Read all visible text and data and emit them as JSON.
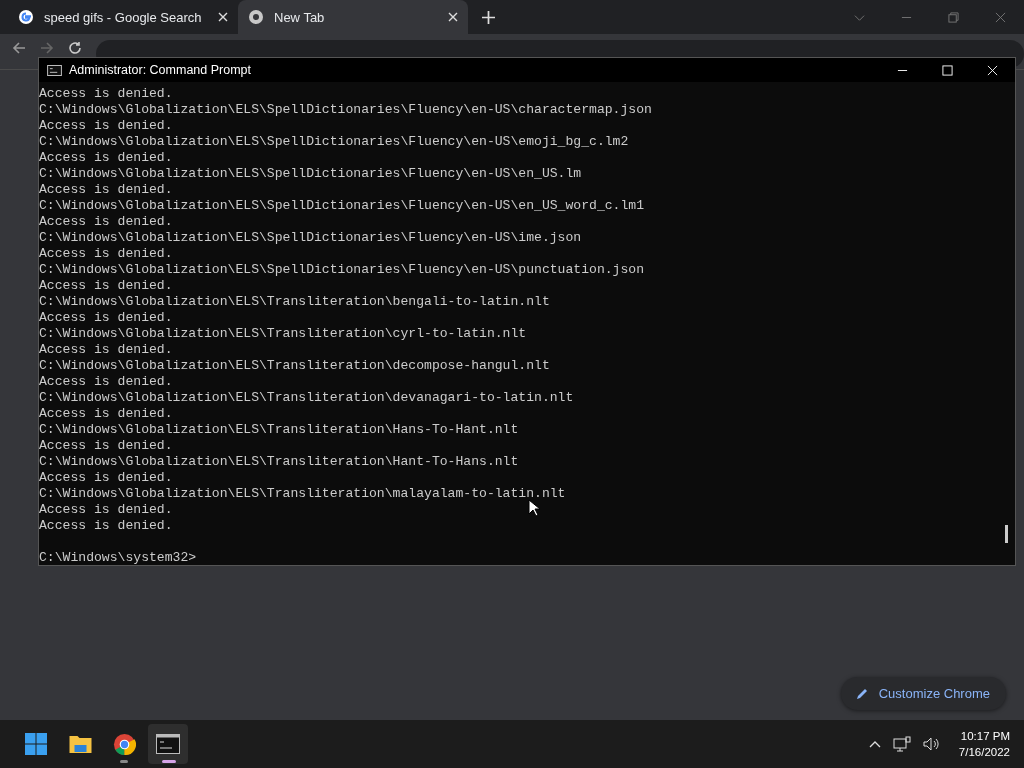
{
  "browser": {
    "tabs": [
      {
        "title": "speed gifs - Google Search",
        "selected": false
      },
      {
        "title": "New Tab",
        "selected": true
      }
    ],
    "customize_button": "Customize Chrome"
  },
  "console": {
    "title": "Administrator: Command Prompt",
    "lines": [
      "Access is denied.",
      "C:\\Windows\\Globalization\\ELS\\SpellDictionaries\\Fluency\\en-US\\charactermap.json",
      "Access is denied.",
      "C:\\Windows\\Globalization\\ELS\\SpellDictionaries\\Fluency\\en-US\\emoji_bg_c.lm2",
      "Access is denied.",
      "C:\\Windows\\Globalization\\ELS\\SpellDictionaries\\Fluency\\en-US\\en_US.lm",
      "Access is denied.",
      "C:\\Windows\\Globalization\\ELS\\SpellDictionaries\\Fluency\\en-US\\en_US_word_c.lm1",
      "Access is denied.",
      "C:\\Windows\\Globalization\\ELS\\SpellDictionaries\\Fluency\\en-US\\ime.json",
      "Access is denied.",
      "C:\\Windows\\Globalization\\ELS\\SpellDictionaries\\Fluency\\en-US\\punctuation.json",
      "Access is denied.",
      "C:\\Windows\\Globalization\\ELS\\Transliteration\\bengali-to-latin.nlt",
      "Access is denied.",
      "C:\\Windows\\Globalization\\ELS\\Transliteration\\cyrl-to-latin.nlt",
      "Access is denied.",
      "C:\\Windows\\Globalization\\ELS\\Transliteration\\decompose-hangul.nlt",
      "Access is denied.",
      "C:\\Windows\\Globalization\\ELS\\Transliteration\\devanagari-to-latin.nlt",
      "Access is denied.",
      "C:\\Windows\\Globalization\\ELS\\Transliteration\\Hans-To-Hant.nlt",
      "Access is denied.",
      "C:\\Windows\\Globalization\\ELS\\Transliteration\\Hant-To-Hans.nlt",
      "Access is denied.",
      "C:\\Windows\\Globalization\\ELS\\Transliteration\\malayalam-to-latin.nlt",
      "Access is denied.",
      "Access is denied."
    ],
    "prompt": "C:\\Windows\\system32>"
  },
  "taskbar": {
    "apps": [
      {
        "kind": "start",
        "running": false,
        "active": false
      },
      {
        "kind": "folder",
        "running": false,
        "active": false
      },
      {
        "kind": "chrome",
        "running": true,
        "active": false
      },
      {
        "kind": "terminal",
        "running": true,
        "active": true
      }
    ],
    "time": "10:17 PM",
    "date": "7/16/2022"
  }
}
